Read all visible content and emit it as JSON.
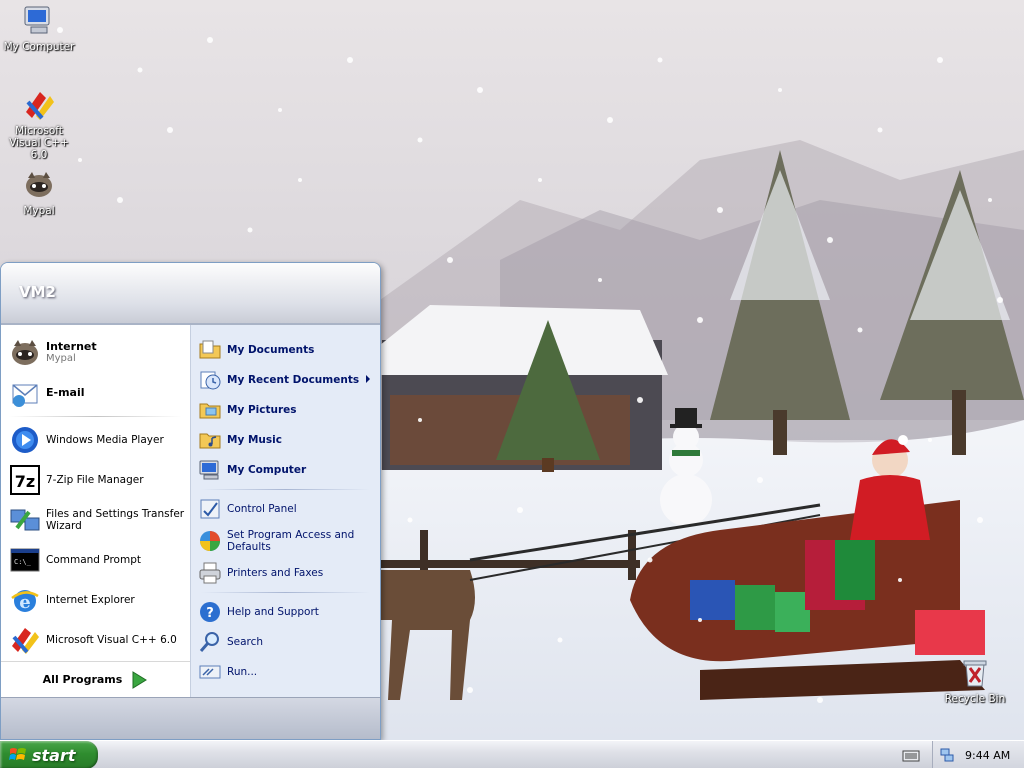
{
  "desktop": {
    "icons": [
      {
        "label": "My Computer",
        "icon": "my-computer-icon"
      },
      {
        "label": "Microsoft Visual C++ 6.0",
        "icon": "visual-cpp-icon"
      },
      {
        "label": "Mypal",
        "icon": "mypal-icon"
      },
      {
        "label": "Recycle Bin",
        "icon": "recycle-bin-icon"
      }
    ]
  },
  "start_menu": {
    "user_name": "VM2",
    "pinned": [
      {
        "title": "Internet",
        "subtitle": "Mypal",
        "icon": "mypal-icon"
      },
      {
        "title": "E-mail",
        "icon": "email-icon"
      }
    ],
    "recent": [
      {
        "label": "Windows Media Player",
        "icon": "media-player-icon"
      },
      {
        "label": "7-Zip File Manager",
        "icon": "7zip-icon"
      },
      {
        "label": "Files and Settings Transfer Wizard",
        "icon": "transfer-wizard-icon"
      },
      {
        "label": "Command Prompt",
        "icon": "command-prompt-icon"
      },
      {
        "label": "Internet Explorer",
        "icon": "internet-explorer-icon"
      },
      {
        "label": "Microsoft Visual C++ 6.0",
        "icon": "visual-cpp-icon"
      }
    ],
    "all_programs": "All Programs",
    "places": [
      {
        "label": "My Documents",
        "icon": "my-documents-icon"
      },
      {
        "label": "My Recent Documents",
        "icon": "recent-documents-icon"
      },
      {
        "label": "My Pictures",
        "icon": "my-pictures-icon"
      },
      {
        "label": "My Music",
        "icon": "my-music-icon"
      },
      {
        "label": "My Computer",
        "icon": "my-computer-icon"
      }
    ],
    "settings": [
      {
        "label": "Control Panel",
        "icon": "control-panel-icon"
      },
      {
        "label": "Set Program Access and Defaults",
        "icon": "program-access-icon"
      },
      {
        "label": "Printers and Faxes",
        "icon": "printer-icon"
      }
    ],
    "help": [
      {
        "label": "Help and Support",
        "icon": "help-icon"
      },
      {
        "label": "Search",
        "icon": "search-icon"
      },
      {
        "label": "Run...",
        "icon": "run-icon"
      }
    ]
  },
  "taskbar": {
    "start_label": "start",
    "clock": "9:44 AM"
  },
  "colors": {
    "taskbar_start_green": "#2f8d2f",
    "menu_right_pane": "#e4ebf7",
    "menu_link_text": "#00136b"
  }
}
